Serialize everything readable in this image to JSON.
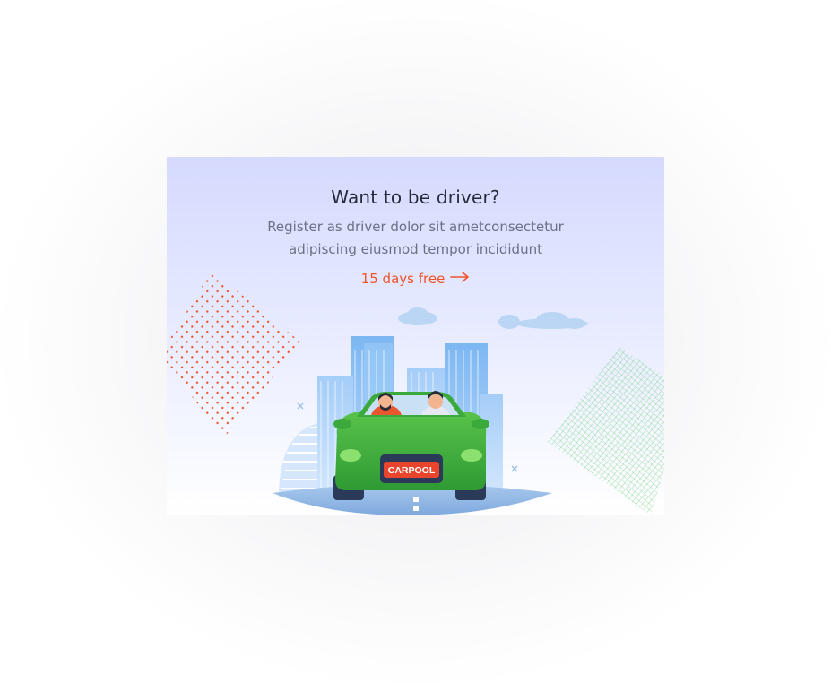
{
  "card": {
    "title": "Want to be driver?",
    "description": "Register as driver dolor sit ametconsectetur adipiscing eiusmod tempor incididunt",
    "cta_label": "15 days free",
    "cta_icon": "arrow-right-icon"
  },
  "illustration": {
    "plate_text": "CARPOOL",
    "car_color": "#3fae3a",
    "plate_color": "#e8452c",
    "accent_dots_color": "#f0532a",
    "grid_color": "#4cc45a",
    "building_color": "#8fc2f5"
  }
}
